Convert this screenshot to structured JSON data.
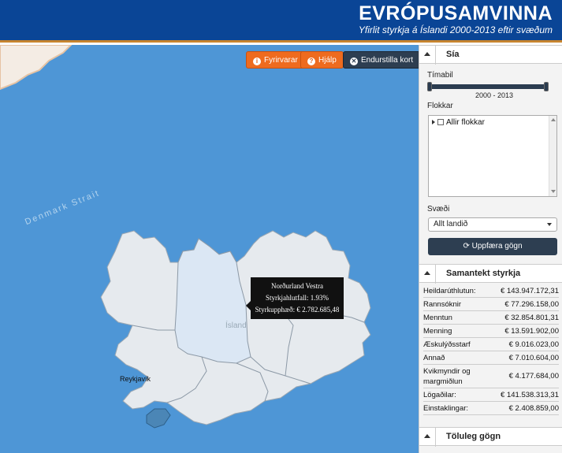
{
  "header": {
    "title": "EVRÓPUSAMVINNA",
    "subtitle": "Yfirlit styrkja á Íslandi 2000-2013 eftir svæðum"
  },
  "map": {
    "buttons": [
      {
        "label": "Fyrirvarar",
        "icon": "info-icon"
      },
      {
        "label": "Hjálp",
        "icon": "help-icon"
      },
      {
        "label": "Endurstilla kort",
        "icon": "close-icon"
      }
    ],
    "water_label": "Denmark Strait",
    "country_label": "Ísland",
    "city_label": "Reykjavík",
    "tooltip": {
      "region": "Norðurland Vestra",
      "share": "Styrkjahlutfall: 1.93%",
      "amount": "Styrkupphæð: € 2.782.685,48"
    },
    "colors": {
      "sea": "#4e96d6",
      "land": "#e6eaee",
      "highlight": "#dbe7f4",
      "capital": "#4b86b6"
    }
  },
  "sidebar": {
    "filter_title": "Sía",
    "timabil_label": "Tímabil",
    "timabil_value": "2000 - 2013",
    "flokkar_label": "Flokkar",
    "flokkar_item": "Allir flokkar",
    "svaedi_label": "Svæði",
    "svaedi_value": "Allt landið",
    "update_label": "Uppfæra gögn",
    "summary_title": "Samantekt styrkja",
    "summary": [
      {
        "k": "Heildarúthlutun:",
        "v": "€ 143.947.172,31"
      },
      {
        "k": "Rannsóknir",
        "v": "€ 77.296.158,00"
      },
      {
        "k": "Menntun",
        "v": "€ 32.854.801,31"
      },
      {
        "k": "Menning",
        "v": "€ 13.591.902,00"
      },
      {
        "k": "Æskulýðsstarf",
        "v": "€ 9.016.023,00"
      },
      {
        "k": "Annað",
        "v": "€ 7.010.604,00"
      },
      {
        "k": "Kvikmyndir og margmiðlun",
        "v": "€ 4.177.684,00"
      },
      {
        "k": "Lögaðilar:",
        "v": "€ 141.538.313,31"
      },
      {
        "k": "Einstaklingar:",
        "v": "€ 2.408.859,00"
      }
    ],
    "numbers_title": "Töluleg gögn"
  }
}
